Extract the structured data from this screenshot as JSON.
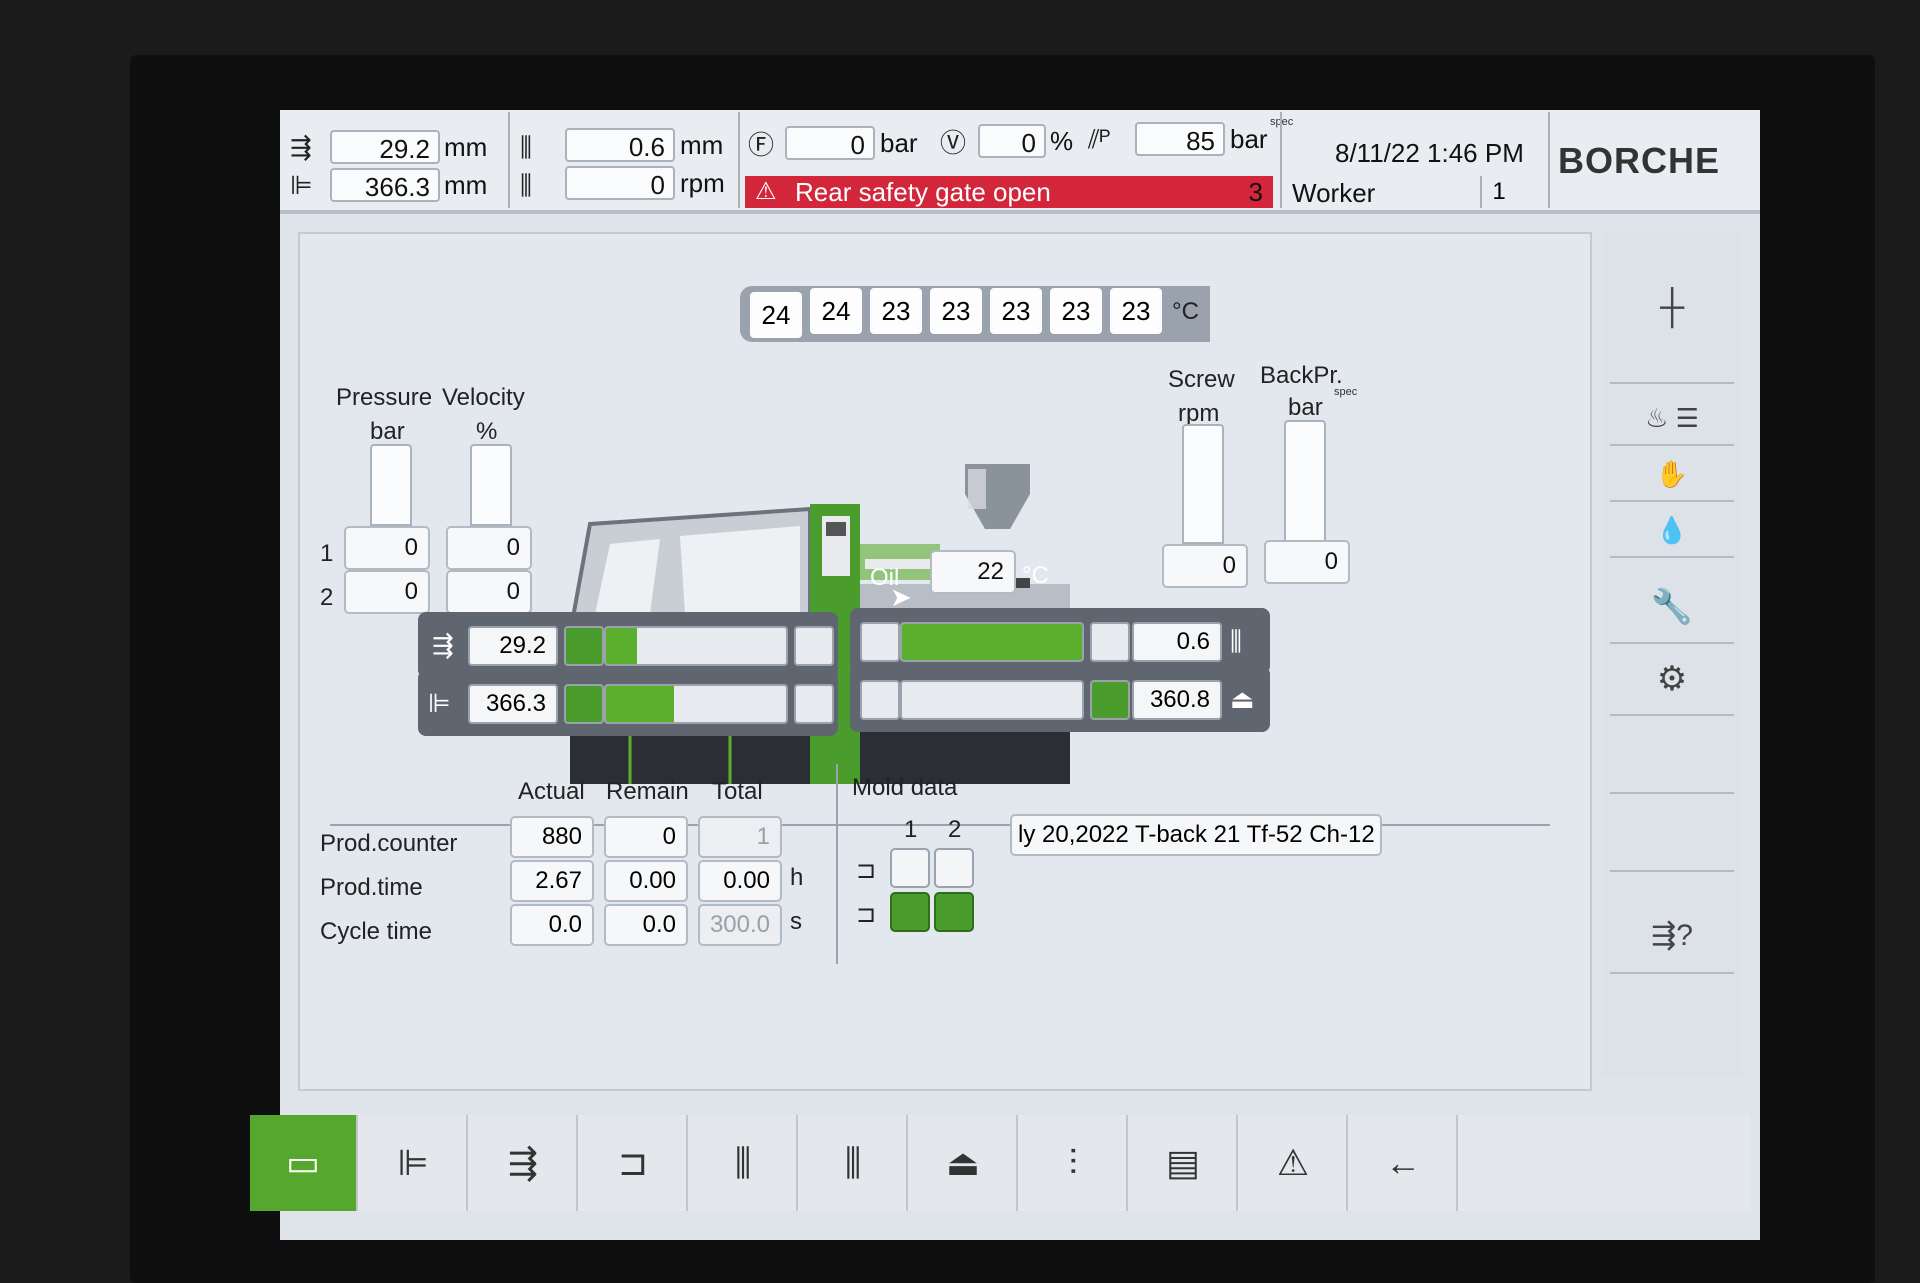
{
  "header": {
    "inject_pos": {
      "value": "29.2",
      "unit": "mm"
    },
    "mold_pos": {
      "value": "366.3",
      "unit": "mm"
    },
    "screw_pos": {
      "value": "0.6",
      "unit": "mm"
    },
    "screw_speed": {
      "value": "0",
      "unit": "rpm"
    },
    "force": {
      "value": "0",
      "unit": "bar"
    },
    "valve": {
      "value": "0",
      "unit": "%"
    },
    "pressure": {
      "value": "85",
      "unit": "bar",
      "sup": "spec"
    },
    "alarm": {
      "text": "Rear safety gate open",
      "count": "3"
    },
    "datetime": "8/11/22 1:46 PM",
    "user": "Worker",
    "user_level": "1",
    "logo": "BORCHE"
  },
  "barrel": {
    "temps": [
      "24",
      "24",
      "23",
      "23",
      "23",
      "23",
      "23"
    ],
    "unit": "°C"
  },
  "left_gauges": {
    "pressure_label": "Pressure",
    "pressure_unit": "bar",
    "velocity_label": "Velocity",
    "velocity_unit": "%",
    "rows": [
      {
        "label": "1",
        "pressure": "0",
        "velocity": "0"
      },
      {
        "label": "2",
        "pressure": "0",
        "velocity": "0"
      }
    ]
  },
  "right_gauges": {
    "screw_label": "Screw",
    "screw_unit": "rpm",
    "screw_value": "0",
    "backpr_label": "BackPr.",
    "backpr_unit": "bar",
    "backpr_sup": "spec",
    "backpr_value": "0"
  },
  "oil": {
    "label": "Oil",
    "value": "22",
    "unit": "°C"
  },
  "position_bars": {
    "inject": {
      "value": "29.2",
      "fill": 0.17
    },
    "mold": {
      "value": "366.3",
      "fill": 0.38
    },
    "screw": {
      "value": "0.6",
      "fill": 1.0
    },
    "ejector": {
      "value": "360.8",
      "fill": 0.0
    }
  },
  "counters": {
    "headers": [
      "Actual",
      "Remain",
      "Total"
    ],
    "rows": [
      {
        "label": "Prod.counter",
        "actual": "880",
        "remain": "0",
        "total": "1",
        "unit": ""
      },
      {
        "label": "Prod.time",
        "actual": "2.67",
        "remain": "0.00",
        "total": "0.00",
        "unit": "h"
      },
      {
        "label": "Cycle time",
        "actual": "0.0",
        "remain": "0.0",
        "total": "300.0",
        "unit": "s"
      }
    ]
  },
  "mold": {
    "label": "Mold data",
    "name": "ly 20,2022 T-back 21 Tf-52 Ch-12",
    "columns": [
      "1",
      "2"
    ]
  },
  "colors": {
    "accent": "#55a82d",
    "alarm": "#d3263a",
    "panel": "#e3e8ee"
  }
}
